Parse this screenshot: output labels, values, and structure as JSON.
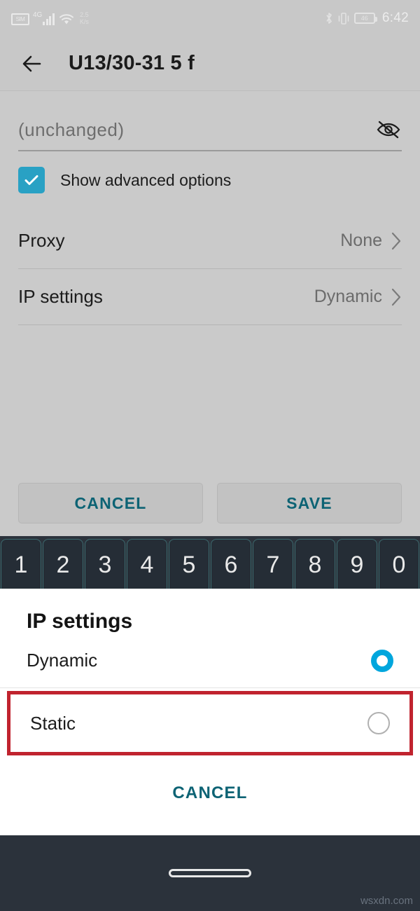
{
  "status_bar": {
    "sim_label": "SIM",
    "network_type": "4G",
    "data_rate_value": "2.5",
    "data_rate_unit": "K/s",
    "battery_percent": "46",
    "time": "6:42",
    "icons": [
      "sim-icon",
      "signal-bars-icon",
      "wifi-icon",
      "bluetooth-icon",
      "vibrate-icon",
      "battery-icon"
    ]
  },
  "app_bar": {
    "back_icon": "back-arrow-icon",
    "title": "U13/30-31 5 f"
  },
  "wifi_form": {
    "password_placeholder": "(unchanged)",
    "password_value": "",
    "toggle_visibility_icon": "eye-off-icon",
    "advanced_checkbox_label": "Show advanced options",
    "advanced_checkbox_checked": true,
    "rows": [
      {
        "label": "Proxy",
        "value": "None"
      },
      {
        "label": "IP settings",
        "value": "Dynamic"
      }
    ],
    "cancel_label": "CANCEL",
    "save_label": "SAVE"
  },
  "keyboard": {
    "number_row": [
      "1",
      "2",
      "3",
      "4",
      "5",
      "6",
      "7",
      "8",
      "9",
      "0"
    ]
  },
  "dialog": {
    "title": "IP settings",
    "options": [
      {
        "label": "Dynamic",
        "selected": true,
        "highlighted": false
      },
      {
        "label": "Static",
        "selected": false,
        "highlighted": true
      }
    ],
    "cancel_label": "CANCEL"
  },
  "nav_bar": {
    "home_pill": "home-gesture-pill"
  },
  "watermark": "wsxdn.com",
  "colors": {
    "accent_teal": "#0d6374",
    "checkbox_teal": "#29a1c4",
    "radio_cyan": "#00a6dd",
    "highlight_red": "#c0232e",
    "screen_bg": "#cacaca",
    "keyboard_bg": "#2b323b",
    "key_bg": "#252d36",
    "key_border": "#3d6b70",
    "dialog_bg": "#ffffff"
  }
}
